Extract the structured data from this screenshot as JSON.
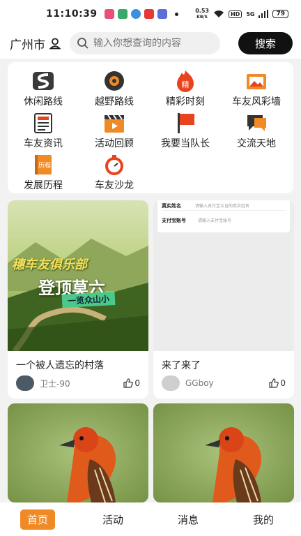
{
  "status_bar": {
    "time": "11:10:39",
    "net_speed_value": "0.53",
    "net_speed_unit": "KB/S",
    "hd": "HD",
    "signal": "5G",
    "battery": "79"
  },
  "header": {
    "city": "广州市",
    "search_placeholder": "输入你想查询的内容",
    "search_button": "搜索"
  },
  "categories": [
    {
      "label": "休闲路线",
      "icon": "road-icon"
    },
    {
      "label": "越野路线",
      "icon": "tire-icon"
    },
    {
      "label": "精彩时刻",
      "icon": "jing-badge-icon"
    },
    {
      "label": "车友风彩墙",
      "icon": "photo-wall-icon"
    },
    {
      "label": "车友资讯",
      "icon": "news-icon"
    },
    {
      "label": "活动回顾",
      "icon": "clapper-icon"
    },
    {
      "label": "我要当队长",
      "icon": "flag-icon"
    },
    {
      "label": "交流天地",
      "icon": "chat-icon"
    },
    {
      "label": "发展历程",
      "icon": "history-book-icon"
    },
    {
      "label": "车友沙龙",
      "icon": "salon-timer-icon"
    }
  ],
  "history_icon_text": "历程",
  "jing_icon_text": "精",
  "posts": [
    {
      "title": "一个被人遗忘的村落",
      "author": "卫士-90",
      "likes": "0",
      "image_text": {
        "line1": "穗车友俱乐部",
        "line2": "登顶莫六",
        "ribbon": "一览众山小"
      }
    },
    {
      "title": "来了来了",
      "author": "GGboy",
      "likes": "0",
      "form": [
        {
          "label": "真实姓名",
          "placeholder": "请输入支付宝认证的真实姓名"
        },
        {
          "label": "支付宝账号",
          "placeholder": "请输入支付宝账号"
        }
      ]
    },
    {
      "title": "",
      "author": "",
      "likes": ""
    },
    {
      "title": "",
      "author": "",
      "likes": ""
    }
  ],
  "bottom_nav": [
    {
      "label": "首页",
      "active": true
    },
    {
      "label": "活动",
      "active": false
    },
    {
      "label": "消息",
      "active": false
    },
    {
      "label": "我的",
      "active": false
    }
  ],
  "colors": {
    "accent_orange": "#f08a27",
    "search_button_bg": "#111111",
    "page_bg": "#f2f2f2"
  }
}
